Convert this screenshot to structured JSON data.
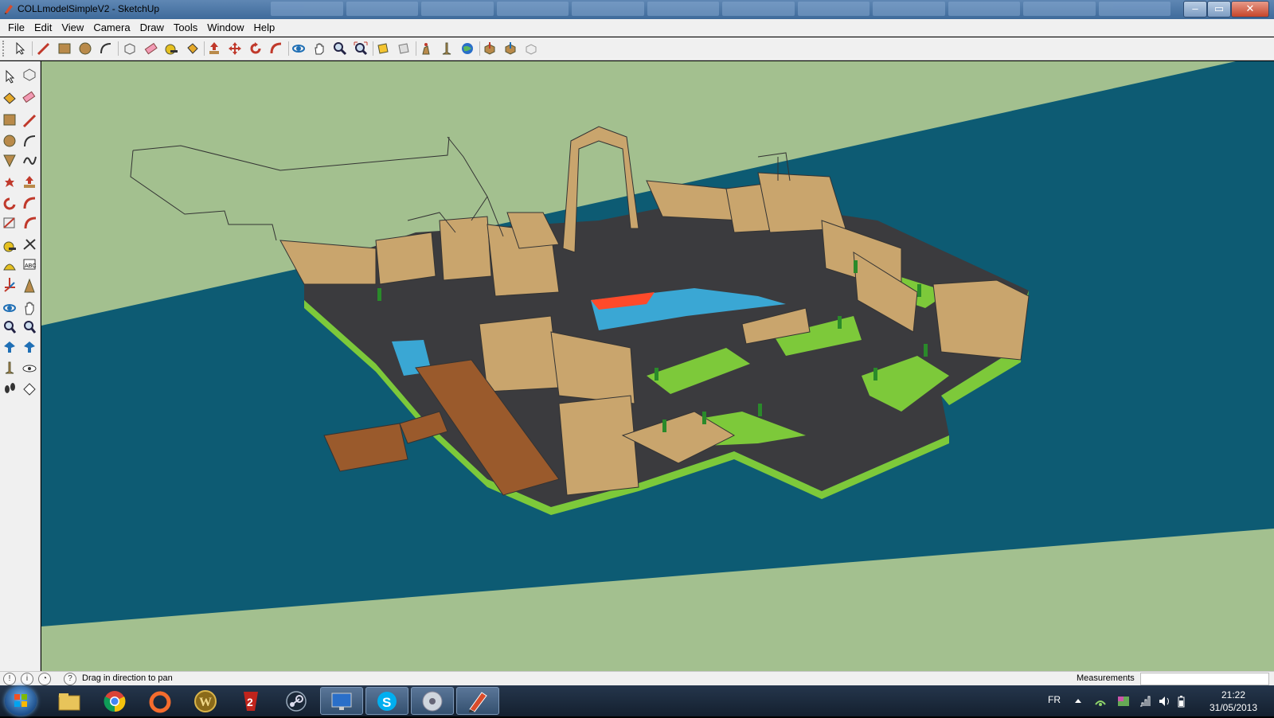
{
  "window": {
    "title": "COLLmodelSimpleV2 - SketchUp",
    "minimize_label": "‒",
    "maximize_label": "▭",
    "close_label": "✕"
  },
  "menu": {
    "items": [
      "File",
      "Edit",
      "View",
      "Camera",
      "Draw",
      "Tools",
      "Window",
      "Help"
    ]
  },
  "toolbar": {
    "icons": [
      "select-icon",
      "make-component-icon",
      "pencil-line-icon",
      "rectangle-icon",
      "circle-icon",
      "arc-icon",
      "eraser-face-icon",
      "eraser-icon",
      "tape-measure-icon",
      "paint-bucket-icon",
      "push-pull-icon",
      "move-icon",
      "rotate-icon",
      "follow-me-icon",
      "orbit-icon",
      "pan-icon",
      "zoom-icon",
      "zoom-extents-icon",
      "section-plane-icon",
      "section-display-icon",
      "walk-icon",
      "position-camera-icon",
      "google-earth-icon",
      "get-models-icon",
      "share-model-icon",
      "share-component-icon"
    ]
  },
  "lefttools": {
    "icons": [
      "select-icon",
      "make-component-icon",
      "paint-bucket-icon",
      "eraser-icon",
      "rectangle-icon",
      "line-icon",
      "circle-icon",
      "arc-icon",
      "polygon-icon",
      "freehand-icon",
      "move-icon",
      "push-pull-icon",
      "rotate-icon",
      "follow-me-icon",
      "scale-icon",
      "offset-icon",
      "tape-measure-icon",
      "dimension-icon",
      "protractor-icon",
      "text-icon",
      "axes-icon",
      "3d-text-icon",
      "orbit-icon",
      "pan-icon",
      "zoom-icon",
      "zoom-window-icon",
      "previous-view-icon",
      "next-view-icon",
      "position-camera-icon",
      "look-around-icon",
      "walk-icon",
      "section-plane-icon"
    ]
  },
  "status": {
    "hint": "Drag in direction to pan",
    "measurements_label": "Measurements",
    "measurements_value": ""
  },
  "taskbar": {
    "apps": [
      "windows-explorer",
      "chrome",
      "origin",
      "world-of-warcraft",
      "guild-wars-2",
      "steam",
      "monitor-app",
      "skype",
      "media-app",
      "sketchup"
    ],
    "active_app": "sketchup",
    "language": "FR",
    "time": "21:22",
    "date": "31/05/2013"
  },
  "colors": {
    "ground": "#a3c08f",
    "water": "#0d5b73",
    "building": "#c9a56d",
    "grass": "#7dc93a",
    "floor": "#3b3b3e",
    "dock": "#9a5a2c",
    "pool": "#3aa7d4",
    "highlight": "#ff4a2a"
  }
}
